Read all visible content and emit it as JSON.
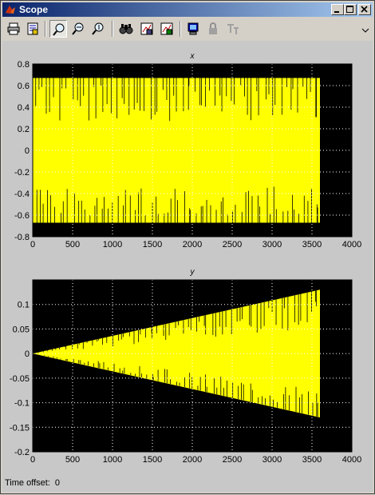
{
  "window": {
    "title": "Scope"
  },
  "toolbar": {
    "buttons": [
      "print-icon",
      "parameters-icon",
      "zoom-icon",
      "zoom-x-icon",
      "zoom-y-icon",
      "autoscale-icon",
      "save-axes-icon",
      "restore-axes-icon",
      "floating-scope-icon",
      "lock-icon",
      "signal-selection-icon"
    ],
    "pressed": "zoom-icon"
  },
  "colors": {
    "background": "#000000",
    "signal": "#ffff00",
    "grid": "#ffffff",
    "frame": "#d4d0c8"
  },
  "footer": {
    "time_offset_label": "Time offset:",
    "time_offset_value": "0"
  },
  "chart_data": [
    {
      "type": "line",
      "title": "x",
      "xlim": [
        0,
        4000
      ],
      "ylim": [
        -0.8,
        0.8
      ],
      "xticks": [
        0,
        500,
        1000,
        1500,
        2000,
        2500,
        3000,
        3500,
        4000
      ],
      "yticks": [
        -0.8,
        -0.6,
        -0.4,
        -0.2,
        0,
        0.2,
        0.4,
        0.6,
        0.8
      ],
      "xtick_labels": [
        "0",
        "500",
        "1000",
        "1500",
        "2000",
        "2500",
        "3000",
        "3500",
        "4000"
      ],
      "ytick_labels": [
        "-0.8",
        "-0.6",
        "-0.4",
        "-0.2",
        "0",
        "0.2",
        "0.4",
        "0.6",
        "0.8"
      ],
      "grid": true,
      "series": [
        {
          "color": "#ffff00",
          "x_range": [
            0,
            3600
          ],
          "envelope_upper": [
            0.67,
            0.67
          ],
          "envelope_lower": [
            -0.67,
            -0.67
          ]
        }
      ]
    },
    {
      "type": "line",
      "title": "y",
      "xlim": [
        0,
        4000
      ],
      "ylim": [
        -0.2,
        0.15
      ],
      "xticks": [
        0,
        500,
        1000,
        1500,
        2000,
        2500,
        3000,
        3500,
        4000
      ],
      "yticks": [
        -0.2,
        -0.15,
        -0.1,
        -0.05,
        0,
        0.05,
        0.1
      ],
      "xtick_labels": [
        "0",
        "500",
        "1000",
        "1500",
        "2000",
        "2500",
        "3000",
        "3500",
        "4000"
      ],
      "ytick_labels": [
        "-0.2",
        "-0.15",
        "-0.1",
        "-0.05",
        "0",
        "0.05",
        "0.1"
      ],
      "grid": true,
      "series": [
        {
          "color": "#ffff00",
          "x_range": [
            0,
            3600
          ],
          "envelope_upper": [
            0,
            0.13
          ],
          "envelope_lower": [
            0,
            -0.13
          ]
        }
      ]
    }
  ]
}
